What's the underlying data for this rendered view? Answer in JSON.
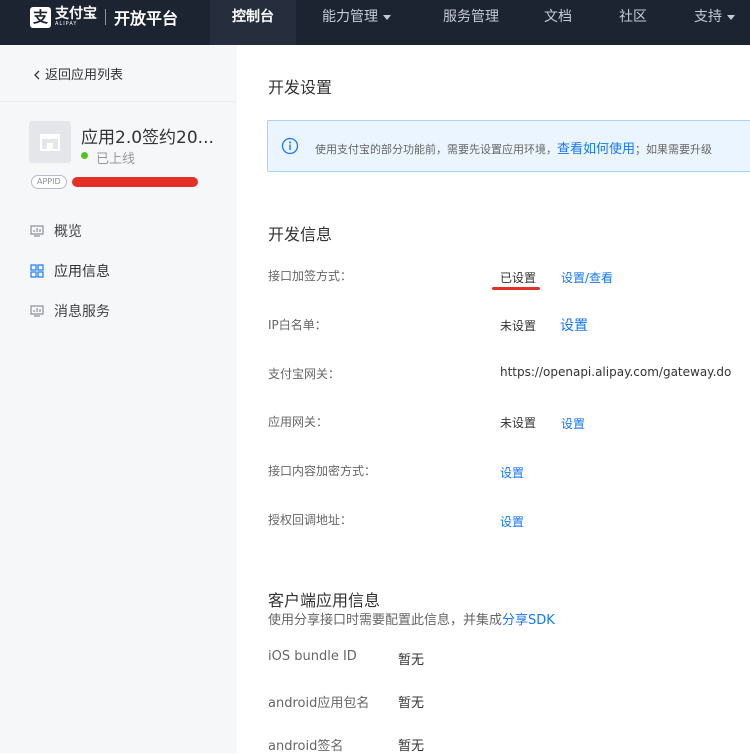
{
  "nav": {
    "logo_glyph": "支",
    "logo_cn": "支付宝",
    "logo_en": "ALIPAY",
    "platform": "开放平台",
    "items": [
      {
        "label": "控制台"
      },
      {
        "label": "能力管理"
      },
      {
        "label": "服务管理"
      },
      {
        "label": "文档"
      },
      {
        "label": "社区"
      },
      {
        "label": "支持"
      }
    ]
  },
  "sidebar": {
    "back_label": "返回应用列表",
    "app_name": "应用2.0签约20...",
    "status": "已上线",
    "appid_label": "APPID",
    "menu": [
      {
        "label": "概览",
        "icon": "monitor-icon"
      },
      {
        "label": "应用信息",
        "icon": "grid-icon"
      },
      {
        "label": "消息服务",
        "icon": "monitor-icon"
      }
    ]
  },
  "main": {
    "dev_settings_title": "开发设置",
    "notice": {
      "before": "使用支付宝的部分功能前，需要先设置应用环境，",
      "link": "查看如何使用",
      "after": "；如果需要升级"
    },
    "dev_info_title": "开发信息",
    "rows": [
      {
        "label": "接口加签方式：",
        "value": "已设置",
        "link": "设置/查看"
      },
      {
        "label": "IP白名单：",
        "value": "未设置",
        "link": "设置"
      },
      {
        "label": "支付宝网关：",
        "value": "https://openapi.alipay.com/gateway.do"
      },
      {
        "label": "应用网关：",
        "value": "未设置",
        "link": "设置"
      },
      {
        "label": "接口内容加密方式：",
        "link": "设置"
      },
      {
        "label": "授权回调地址：",
        "link": "设置"
      }
    ],
    "client_title": "客户端应用信息",
    "client_note": "使用分享接口时需要配置此信息，并集成",
    "client_note_link": "分享SDK",
    "client_rows": [
      {
        "label": "iOS bundle ID",
        "value": "暂无"
      },
      {
        "label": "android应用包名",
        "value": "暂无"
      },
      {
        "label": "android签名",
        "value": "暂无"
      }
    ]
  },
  "colors": {
    "nav_bg": "#1c2331",
    "link_blue": "#1677ff",
    "status_green": "#52c41a",
    "highlight_red": "#e3312a"
  }
}
